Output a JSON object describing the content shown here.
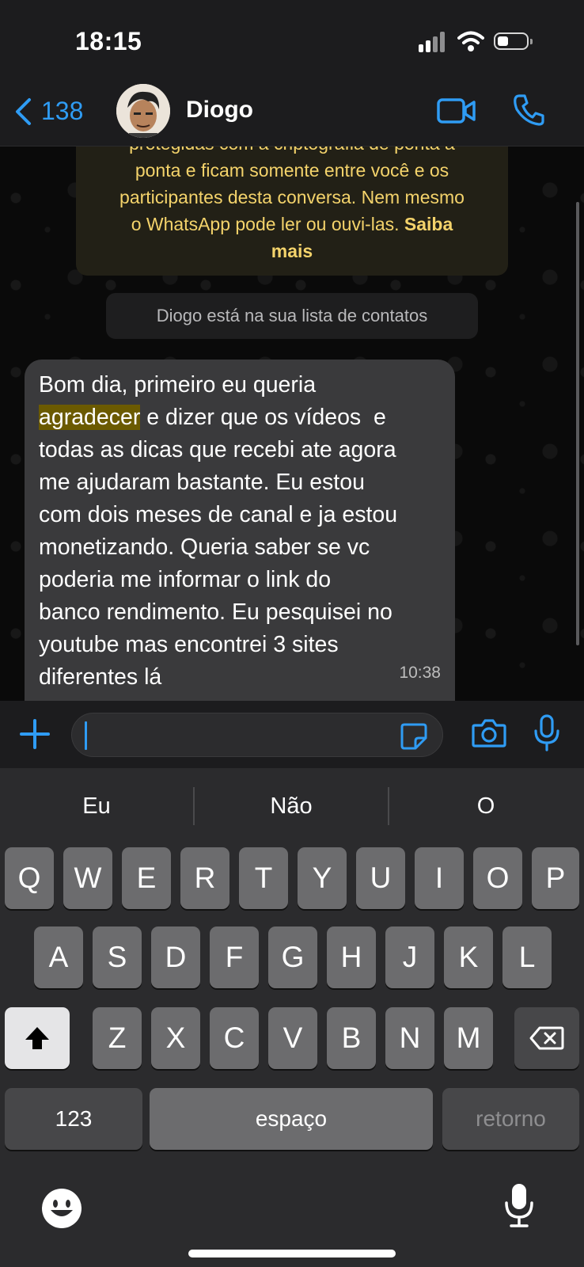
{
  "status_bar": {
    "time": "18:15"
  },
  "header": {
    "back_count": "138",
    "contact_name": "Diogo"
  },
  "chat": {
    "encryption_notice": {
      "line1": "protegidas com a criptografia de ponta a",
      "line2": "ponta e ficam somente entre você e os",
      "line3": "participantes desta conversa. Nem mesmo",
      "line4": "o WhatsApp pode ler ou ouvi-las.",
      "link1": "Saiba",
      "link2": "mais"
    },
    "contact_notice": "Diogo está na sua lista de contatos",
    "message": {
      "l1": "Bom dia, primeiro eu queria",
      "l2_highlight": "agradecer",
      "l2_rest": " e dizer que os vídeos  e",
      "l3": "todas as dicas que recebi ate agora",
      "l4": "me ajudaram bastante. Eu estou",
      "l5": "com dois meses de canal e ja estou",
      "l6": "monetizando. Queria saber se vc",
      "l7": "poderia me informar o link do",
      "l8": "banco rendimento. Eu pesquisei no",
      "l9": "youtube mas encontrei 3 sites",
      "l10": "diferentes lá",
      "time": "10:38"
    }
  },
  "input": {
    "placeholder": ""
  },
  "keyboard": {
    "suggestions": [
      "Eu",
      "Não",
      "O"
    ],
    "row1": [
      "Q",
      "W",
      "E",
      "R",
      "T",
      "Y",
      "U",
      "I",
      "O",
      "P"
    ],
    "row2": [
      "A",
      "S",
      "D",
      "F",
      "G",
      "H",
      "J",
      "K",
      "L"
    ],
    "row3": [
      "Z",
      "X",
      "C",
      "V",
      "B",
      "N",
      "M"
    ],
    "numbers_key": "123",
    "space_key": "espaço",
    "return_key": "retorno"
  },
  "colors": {
    "accent_blue": "#2f9cf4",
    "notice_yellow": "#f4d36b",
    "bubble_bg": "#3a3a3c",
    "highlight": "#6b5a00"
  },
  "icons": [
    "chevron-left-icon",
    "video-camera-icon",
    "phone-icon",
    "plus-icon",
    "sticker-icon",
    "camera-icon",
    "microphone-icon",
    "shift-icon",
    "backspace-icon",
    "emoji-icon",
    "dictation-icon",
    "wifi-icon",
    "signal-icon",
    "battery-icon"
  ]
}
